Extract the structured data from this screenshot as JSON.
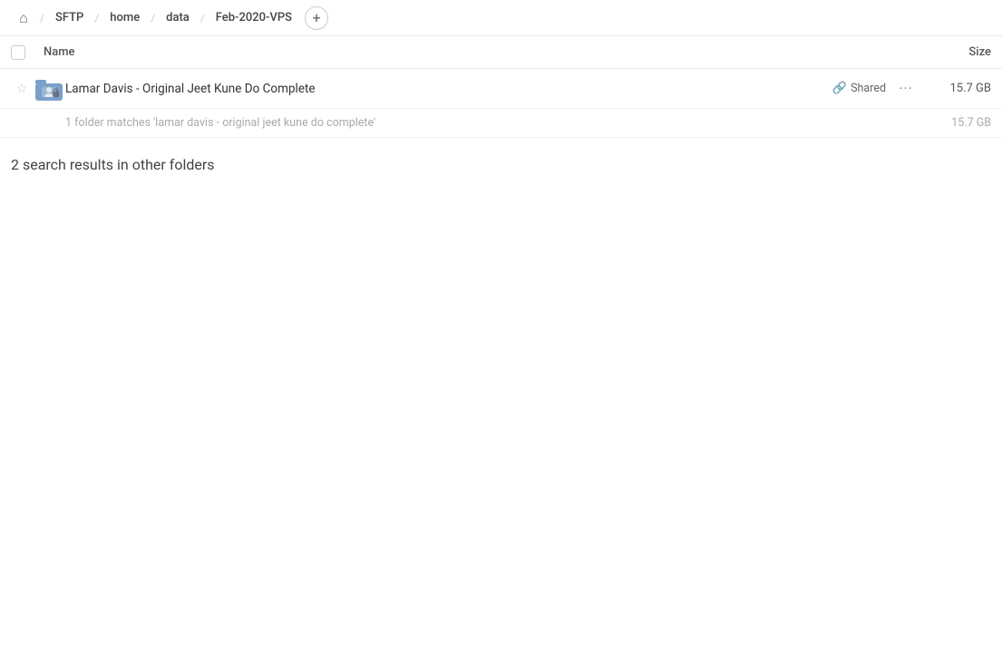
{
  "breadcrumb": {
    "home_icon": "🏠",
    "items": [
      {
        "label": "SFTP",
        "id": "sftp"
      },
      {
        "label": "home",
        "id": "home"
      },
      {
        "label": "data",
        "id": "data"
      },
      {
        "label": "Feb-2020-VPS",
        "id": "feb-2020-vps"
      }
    ],
    "add_label": "+"
  },
  "table": {
    "col_name": "Name",
    "col_size": "Size"
  },
  "file_row": {
    "name": "Lamar Davis - Original Jeet Kune Do Complete",
    "shared_label": "Shared",
    "size": "15.7 GB",
    "more_icon": "···"
  },
  "match_info": {
    "text": "1 folder matches 'lamar davis - original jeet kune do complete'",
    "size": "15.7 GB"
  },
  "other_folders": {
    "heading": "2 search results in other folders"
  }
}
